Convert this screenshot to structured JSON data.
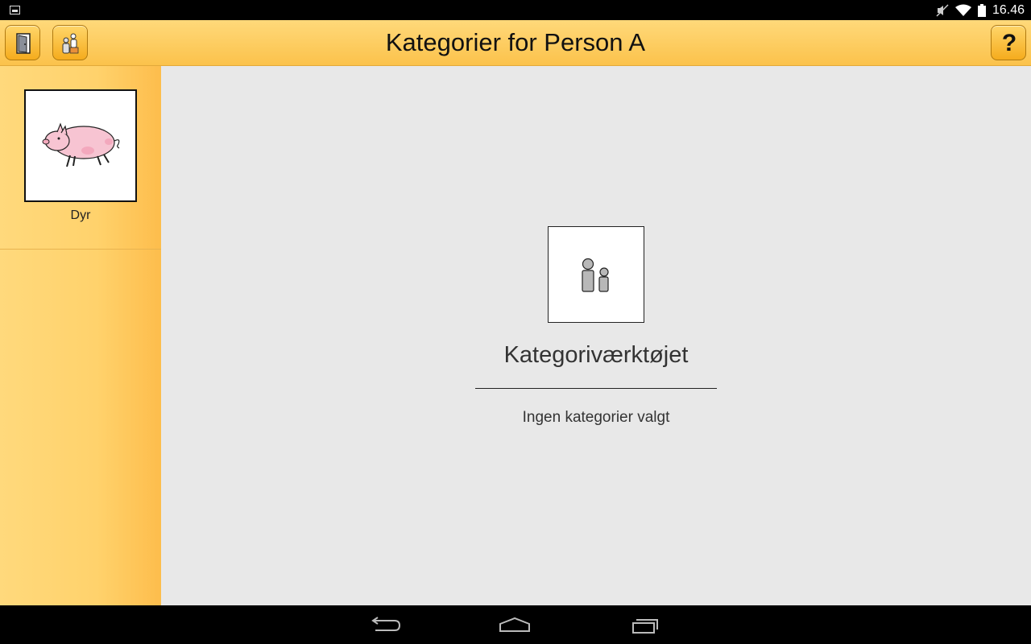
{
  "status_bar": {
    "time": "16.46",
    "icons": [
      "image-notification-icon",
      "mute-icon",
      "wifi-icon",
      "battery-icon"
    ]
  },
  "action_bar": {
    "title": "Kategorier for Person A",
    "left_buttons": [
      "exit-door-icon",
      "persons-icon"
    ],
    "help_label": "?"
  },
  "sidebar": {
    "items": [
      {
        "label": "Dyr",
        "icon": "pig-icon"
      }
    ]
  },
  "main": {
    "tool_icon": "persons-icon",
    "tool_title": "Kategoriværktøjet",
    "empty_text": "Ingen kategorier valgt"
  },
  "nav_bar": {
    "buttons": [
      "back-icon",
      "home-icon",
      "recent-apps-icon"
    ]
  },
  "colors": {
    "accent": "#fbc24b",
    "background": "#e8e8e8",
    "button": "#f5ac1d"
  }
}
